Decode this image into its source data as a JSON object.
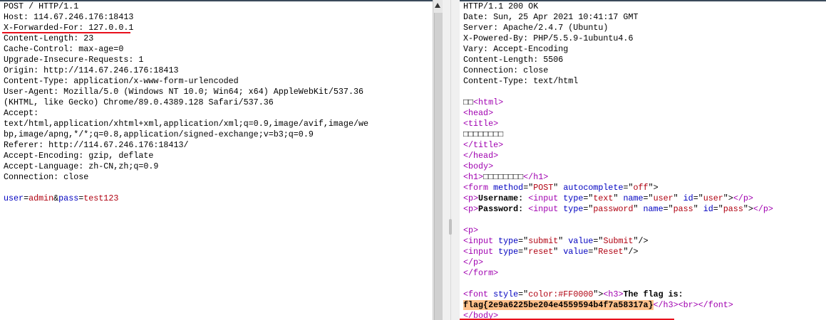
{
  "request": {
    "lines": [
      [
        {
          "t": "POST / HTTP/1.1",
          "c": "n"
        }
      ],
      [
        {
          "t": "Host: 114.67.246.176:18413",
          "c": "n"
        }
      ],
      [
        {
          "t": "X-Forwarded-For: 127.0.0.1",
          "c": "n"
        }
      ],
      [
        {
          "t": "Content-Length: 23",
          "c": "n"
        }
      ],
      [
        {
          "t": "Cache-Control: max-age=0",
          "c": "n"
        }
      ],
      [
        {
          "t": "Upgrade-Insecure-Requests: 1",
          "c": "n"
        }
      ],
      [
        {
          "t": "Origin: http://114.67.246.176:18413",
          "c": "n"
        }
      ],
      [
        {
          "t": "Content-Type: application/x-www-form-urlencoded",
          "c": "n"
        }
      ],
      [
        {
          "t": "User-Agent: Mozilla/5.0 (Windows NT 10.0; Win64; x64) AppleWebKit/537.36",
          "c": "n"
        }
      ],
      [
        {
          "t": "(KHTML, like Gecko) Chrome/89.0.4389.128 Safari/537.36",
          "c": "n"
        }
      ],
      [
        {
          "t": "Accept:",
          "c": "n"
        }
      ],
      [
        {
          "t": "text/html,application/xhtml+xml,application/xml;q=0.9,image/avif,image/we",
          "c": "n"
        }
      ],
      [
        {
          "t": "bp,image/apng,*/*;q=0.8,application/signed-exchange;v=b3;q=0.9",
          "c": "n"
        }
      ],
      [
        {
          "t": "Referer: http://114.67.246.176:18413/",
          "c": "n"
        }
      ],
      [
        {
          "t": "Accept-Encoding: gzip, deflate",
          "c": "n"
        }
      ],
      [
        {
          "t": "Accept-Language: zh-CN,zh;q=0.9",
          "c": "n"
        }
      ],
      [
        {
          "t": "Connection: close",
          "c": "n"
        }
      ],
      [
        {
          "t": " ",
          "c": "n"
        }
      ],
      [
        {
          "t": "user",
          "c": "attr"
        },
        {
          "t": "=",
          "c": "n"
        },
        {
          "t": "admin",
          "c": "val"
        },
        {
          "t": "&",
          "c": "n"
        },
        {
          "t": "pass",
          "c": "attr"
        },
        {
          "t": "=",
          "c": "n"
        },
        {
          "t": "test123",
          "c": "val"
        }
      ]
    ]
  },
  "response": {
    "lines": [
      [
        {
          "t": "HTTP/1.1 200 OK",
          "c": "n"
        }
      ],
      [
        {
          "t": "Date: Sun, 25 Apr 2021 10:41:17 GMT",
          "c": "n"
        }
      ],
      [
        {
          "t": "Server: Apache/2.4.7 (Ubuntu)",
          "c": "n"
        }
      ],
      [
        {
          "t": "X-Powered-By: PHP/5.5.9-1ubuntu4.6",
          "c": "n"
        }
      ],
      [
        {
          "t": "Vary: Accept-Encoding",
          "c": "n"
        }
      ],
      [
        {
          "t": "Content-Length: 5506",
          "c": "n"
        }
      ],
      [
        {
          "t": "Connection: close",
          "c": "n"
        }
      ],
      [
        {
          "t": "Content-Type: text/html",
          "c": "n"
        }
      ],
      [
        {
          "t": " ",
          "c": "n"
        }
      ],
      [
        {
          "t": "□□",
          "c": "n"
        },
        {
          "t": "<html>",
          "c": "tag"
        }
      ],
      [
        {
          "t": "<head>",
          "c": "tag"
        }
      ],
      [
        {
          "t": "<title>",
          "c": "tag"
        }
      ],
      [
        {
          "t": "□□□□□□□□",
          "c": "n"
        }
      ],
      [
        {
          "t": "</title>",
          "c": "tag"
        }
      ],
      [
        {
          "t": "</head>",
          "c": "tag"
        }
      ],
      [
        {
          "t": "<body>",
          "c": "tag"
        }
      ],
      [
        {
          "t": "<h1>",
          "c": "tag"
        },
        {
          "t": "□□□□□□□□",
          "c": "n"
        },
        {
          "t": "</h1>",
          "c": "tag"
        }
      ],
      [
        {
          "t": "<form ",
          "c": "tag"
        },
        {
          "t": "method",
          "c": "attr"
        },
        {
          "t": "=\"",
          "c": "n"
        },
        {
          "t": "POST",
          "c": "val"
        },
        {
          "t": "\" ",
          "c": "n"
        },
        {
          "t": "autocomplete",
          "c": "attr"
        },
        {
          "t": "=\"",
          "c": "n"
        },
        {
          "t": "off",
          "c": "val"
        },
        {
          "t": "\">",
          "c": "n"
        }
      ],
      [
        {
          "t": "<p>",
          "c": "tag"
        },
        {
          "t": "Username:",
          "c": "b"
        },
        {
          "t": " ",
          "c": "n"
        },
        {
          "t": "<input ",
          "c": "tag"
        },
        {
          "t": "type",
          "c": "attr"
        },
        {
          "t": "=\"",
          "c": "n"
        },
        {
          "t": "text",
          "c": "val"
        },
        {
          "t": "\" ",
          "c": "n"
        },
        {
          "t": "name",
          "c": "attr"
        },
        {
          "t": "=\"",
          "c": "n"
        },
        {
          "t": "user",
          "c": "val"
        },
        {
          "t": "\" ",
          "c": "n"
        },
        {
          "t": "id",
          "c": "attr"
        },
        {
          "t": "=\"",
          "c": "n"
        },
        {
          "t": "user",
          "c": "val"
        },
        {
          "t": "\">",
          "c": "n"
        },
        {
          "t": "</p>",
          "c": "tag"
        }
      ],
      [
        {
          "t": "<p>",
          "c": "tag"
        },
        {
          "t": "Password:",
          "c": "b"
        },
        {
          "t": " ",
          "c": "n"
        },
        {
          "t": "<input ",
          "c": "tag"
        },
        {
          "t": "type",
          "c": "attr"
        },
        {
          "t": "=\"",
          "c": "n"
        },
        {
          "t": "password",
          "c": "val"
        },
        {
          "t": "\" ",
          "c": "n"
        },
        {
          "t": "name",
          "c": "attr"
        },
        {
          "t": "=\"",
          "c": "n"
        },
        {
          "t": "pass",
          "c": "val"
        },
        {
          "t": "\" ",
          "c": "n"
        },
        {
          "t": "id",
          "c": "attr"
        },
        {
          "t": "=\"",
          "c": "n"
        },
        {
          "t": "pass",
          "c": "val"
        },
        {
          "t": "\">",
          "c": "n"
        },
        {
          "t": "</p>",
          "c": "tag"
        }
      ],
      [
        {
          "t": " ",
          "c": "n"
        }
      ],
      [
        {
          "t": "<p>",
          "c": "tag"
        }
      ],
      [
        {
          "t": "<input ",
          "c": "tag"
        },
        {
          "t": "type",
          "c": "attr"
        },
        {
          "t": "=\"",
          "c": "n"
        },
        {
          "t": "submit",
          "c": "val"
        },
        {
          "t": "\" ",
          "c": "n"
        },
        {
          "t": "value",
          "c": "attr"
        },
        {
          "t": "=\"",
          "c": "n"
        },
        {
          "t": "Submit",
          "c": "val"
        },
        {
          "t": "\"/>",
          "c": "n"
        }
      ],
      [
        {
          "t": "<input ",
          "c": "tag"
        },
        {
          "t": "type",
          "c": "attr"
        },
        {
          "t": "=\"",
          "c": "n"
        },
        {
          "t": "reset",
          "c": "val"
        },
        {
          "t": "\" ",
          "c": "n"
        },
        {
          "t": "value",
          "c": "attr"
        },
        {
          "t": "=\"",
          "c": "n"
        },
        {
          "t": "Reset",
          "c": "val"
        },
        {
          "t": "\"/>",
          "c": "n"
        }
      ],
      [
        {
          "t": "</p>",
          "c": "tag"
        }
      ],
      [
        {
          "t": "</form>",
          "c": "tag"
        }
      ],
      [
        {
          "t": " ",
          "c": "n"
        }
      ],
      [
        {
          "t": "<font ",
          "c": "tag"
        },
        {
          "t": "style",
          "c": "attr"
        },
        {
          "t": "=\"",
          "c": "n"
        },
        {
          "t": "color:#FF0000",
          "c": "val"
        },
        {
          "t": "\">",
          "c": "n"
        },
        {
          "t": "<h3>",
          "c": "tag"
        },
        {
          "t": "The flag is:",
          "c": "b"
        }
      ],
      [
        {
          "t": "flag{2e9a6225be204e4559594b4f7a58317a}",
          "c": "hl"
        },
        {
          "t": "</h3>",
          "c": "tag"
        },
        {
          "t": "<br>",
          "c": "tag"
        },
        {
          "t": "</font>",
          "c": "tag"
        }
      ],
      [
        {
          "t": "</body>",
          "c": "tag"
        }
      ]
    ]
  },
  "colors": {
    "tag": "#a000b0",
    "attr": "#0000c0",
    "value": "#b00010",
    "highlight": "#ffc08a",
    "annotation": "#e8101c"
  }
}
